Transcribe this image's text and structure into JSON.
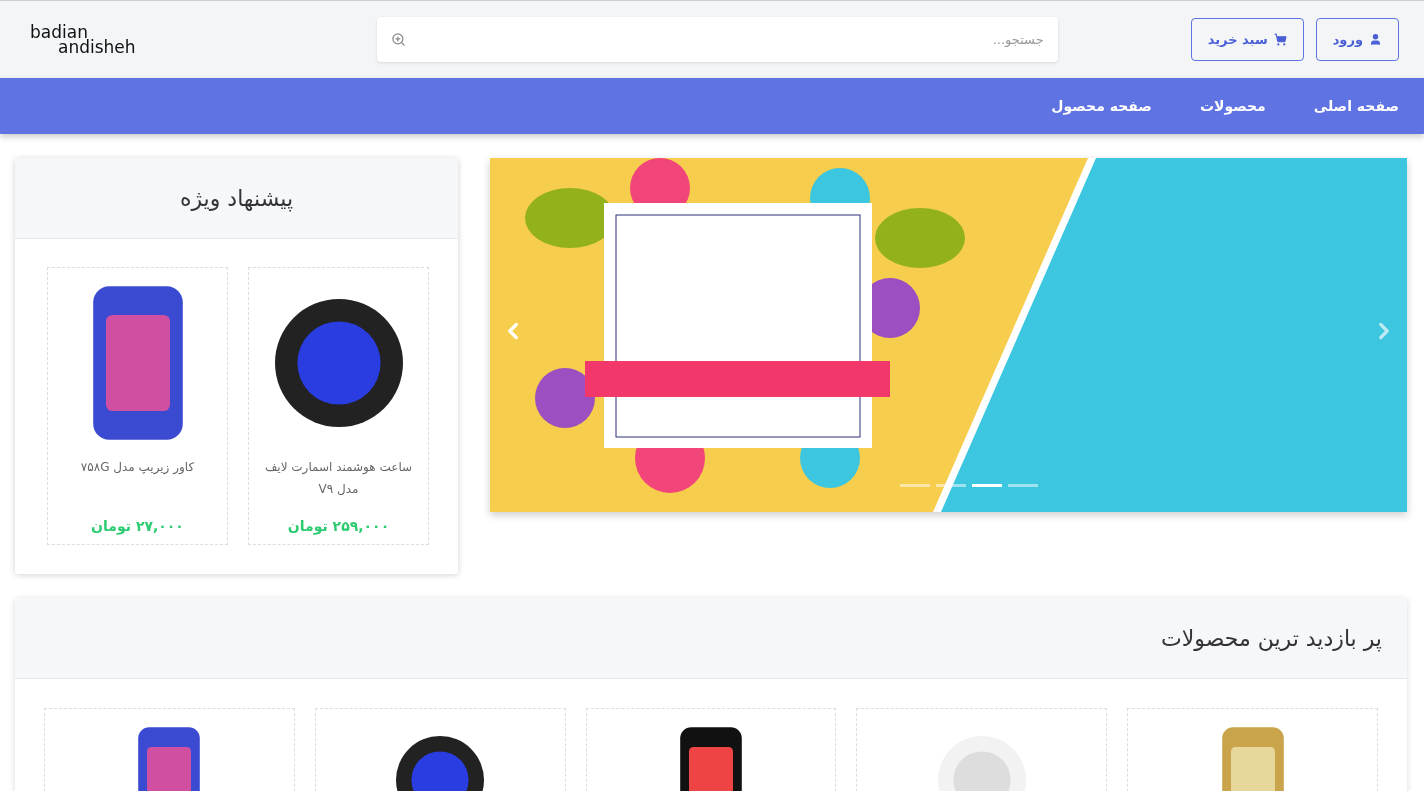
{
  "logo": {
    "line_1": "badian",
    "line_2": "andisheh"
  },
  "header_buttons": [
    {
      "kind": "login",
      "label": "ورود"
    },
    {
      "kind": "cart",
      "label": "سبد خرید"
    }
  ],
  "search": {
    "placeholder": "جستجو..."
  },
  "nav": [
    {
      "label": "صفحه اصلی"
    },
    {
      "label": "محصولات"
    },
    {
      "label": "صفحه محصول"
    }
  ],
  "slider": {
    "indicators": [
      {
        "selected": false
      },
      {
        "selected": false
      },
      {
        "selected": true
      },
      {
        "selected": false
      }
    ]
  },
  "special_offer": {
    "title": "پیشنهاد ویژه",
    "products": [
      {
        "kind": "watch",
        "name": "ساعت هوشمند اسمارت لایف مدل V۹",
        "price": "۲۵۹,۰۰۰ تومان"
      },
      {
        "kind": "phone-case",
        "name": "کاور زیریپ مدل ۷۵۸G",
        "price": "۲۷,۰۰۰ تومان"
      }
    ]
  },
  "most_viewed": {
    "title": "پر بازدید ترین محصولات",
    "products": [
      {
        "kind": "perfume"
      },
      {
        "kind": "earbuds"
      },
      {
        "kind": "phone"
      },
      {
        "kind": "watch"
      },
      {
        "kind": "phone-case"
      }
    ]
  }
}
